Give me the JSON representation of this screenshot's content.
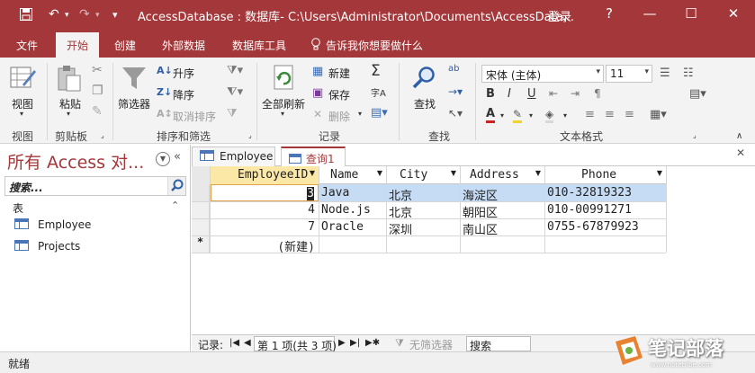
{
  "titlebar": {
    "title": "AccessDatabase : 数据库- C:\\Users\\Administrator\\Documents\\AccessData...",
    "login": "登录",
    "help": "?",
    "undo_glyph": "↶",
    "redo_glyph": "↷",
    "customize_glyph": "▾",
    "minimize_glyph": "—",
    "restore_glyph": "☐",
    "close_glyph": "✕"
  },
  "ribbon_tabs": [
    "文件",
    "开始",
    "创建",
    "外部数据",
    "数据库工具"
  ],
  "tellme": "告诉我你想要做什么",
  "ribbon": {
    "view": "视图",
    "paste": "粘贴",
    "filter": "筛选器",
    "asc": "升序",
    "desc": "降序",
    "clear_sort": "取消排序",
    "refresh_all": "全部刷新",
    "new": "新建",
    "save": "保存",
    "delete": "删除",
    "find": "查找",
    "font_name": "宋体 (主体)",
    "font_size": "11",
    "bold": "B",
    "italic": "I",
    "underline": "U",
    "font_color": "A",
    "groups": {
      "views": "视图",
      "clipboard": "剪贴板",
      "sort_filter": "排序和筛选",
      "records": "记录",
      "find": "查找",
      "text_format": "文本格式"
    }
  },
  "nav": {
    "title": "所有 Access 对...",
    "search_placeholder": "搜索...",
    "group": "表",
    "items": [
      "Employee",
      "Projects"
    ]
  },
  "doc_tabs": [
    "Employee",
    "查询1"
  ],
  "datasheet": {
    "columns": [
      "EmployeeID",
      "Name",
      "City",
      "Address",
      "Phone"
    ],
    "rows": [
      [
        "3",
        "Java",
        "北京",
        "海淀区",
        "010-32819323"
      ],
      [
        "4",
        "Node.js",
        "北京",
        "朝阳区",
        "010-00991271"
      ],
      [
        "7",
        "Oracle",
        "深圳",
        "南山区",
        "0755-67879923"
      ]
    ],
    "new_row_marker": "*",
    "new_row_label": "(新建)"
  },
  "recordbar": {
    "label": "记录:",
    "position": "第 1 项(共 3 项)",
    "filter": "无筛选器",
    "search": "搜索"
  },
  "status": "就绪",
  "watermark": {
    "text": "笔记部落",
    "url": "www.notetribe.com"
  },
  "colors": {
    "accent": "#a4373a",
    "selected_row": "#c6dcf5",
    "header_highlight": "#fbe7a6"
  }
}
